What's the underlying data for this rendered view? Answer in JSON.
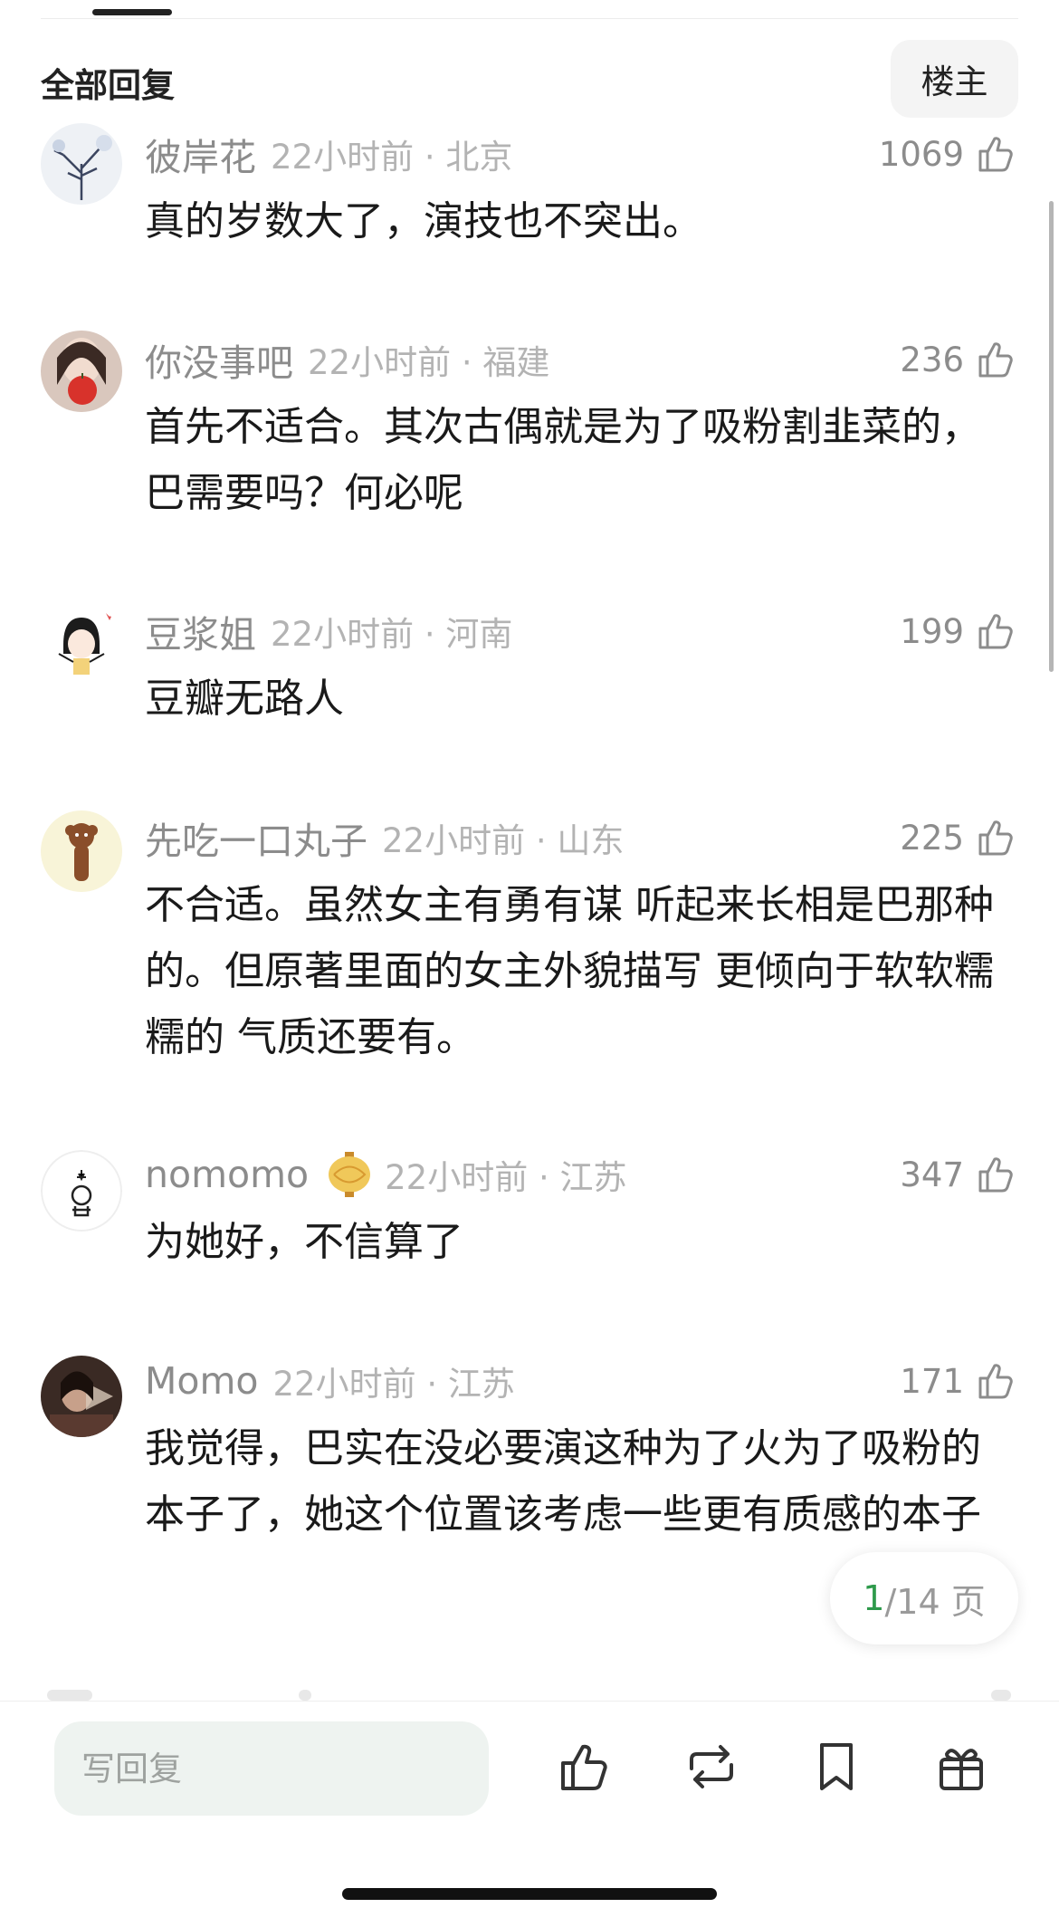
{
  "header": {
    "title": "全部回复",
    "filter_label": "楼主"
  },
  "comments": [
    {
      "username": "彼岸花",
      "time": "22小时前 · 北京",
      "likes": "1069",
      "text": "真的岁数大了，演技也不突出。"
    },
    {
      "username": "你没事吧",
      "time": "22小时前 · 福建",
      "likes": "236",
      "text": "首先不适合。其次古偶就是为了吸粉割韭菜的，巴需要吗？何必呢"
    },
    {
      "username": "豆浆姐",
      "time": "22小时前 · 河南",
      "likes": "199",
      "text": "豆瓣无路人"
    },
    {
      "username": "先吃一口丸子",
      "time": "22小时前 · 山东",
      "likes": "225",
      "text": "不合适。虽然女主有勇有谋 听起来长相是巴那种的。但原著里面的女主外貌描写 更倾向于软软糯糯的 气质还要有。"
    },
    {
      "username": "nomomo",
      "time": "22小时前 · 江苏",
      "likes": "347",
      "text": "为她好，不信算了",
      "badge_icon": "lantern-badge-icon"
    },
    {
      "username": "Momo",
      "time": "22小时前 · 江苏",
      "likes": "171",
      "text": "我觉得，巴实在没必要演这种为了火为了吸粉的本子了，她这个位置该考虑一些更有质感的本子"
    }
  ],
  "pagination": {
    "current": "1",
    "total": "/14 页"
  },
  "bottom_bar": {
    "reply_placeholder": "写回复",
    "actions": [
      "like-icon",
      "repost-icon",
      "bookmark-icon",
      "gift-icon"
    ]
  },
  "colors": {
    "accent": "#2e9a4b",
    "username": "#8c8c8c",
    "time": "#b3b3b3",
    "input_bg": "#eef3f0"
  }
}
